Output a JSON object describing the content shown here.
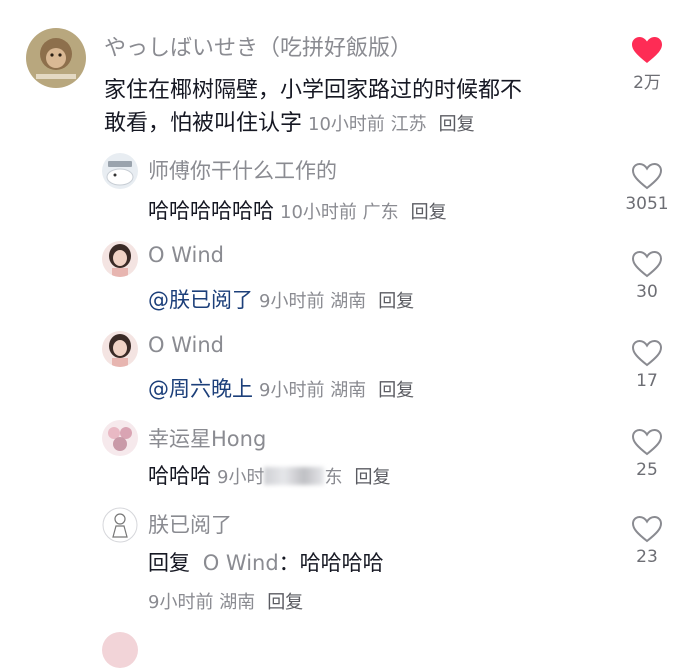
{
  "colors": {
    "accent_like": "#fe2c55",
    "secondary_text": "#8a8b91",
    "primary_text": "#161823"
  },
  "main_comment": {
    "author": "やっしばいせき（吃拼好飯版）",
    "text_line1": "家住在椰树隔壁，小学回家路过的时候都不",
    "text_line2": "敢看，怕被叫住认字",
    "time": "10小时前",
    "location": "江苏",
    "reply_label": "回复",
    "likes": "2万",
    "liked": true,
    "like_icon": "heart-filled-icon"
  },
  "replies": [
    {
      "author": "师傅你干什么工作的",
      "text": "哈哈哈哈哈哈",
      "mention": "",
      "time": "10小时前",
      "location": "广东",
      "reply_label": "回复",
      "likes": "3051",
      "like_icon": "heart-outline-icon"
    },
    {
      "author": "O Wind",
      "text": "",
      "mention": "@朕已阅了",
      "time": "9小时前",
      "location": "湖南",
      "reply_label": "回复",
      "likes": "30",
      "like_icon": "heart-outline-icon"
    },
    {
      "author": "O Wind",
      "text": "",
      "mention": "@周六晚上",
      "time": "9小时前",
      "location": "湖南",
      "reply_label": "回复",
      "likes": "17",
      "like_icon": "heart-outline-icon"
    },
    {
      "author": "幸运星Hong",
      "text": "哈哈哈",
      "mention": "",
      "time_prefix": "9小时",
      "time_suffix": "东",
      "reply_label": "回复",
      "likes": "25",
      "like_icon": "heart-outline-icon"
    },
    {
      "author": "朕已阅了",
      "reply_word": "回复",
      "reply_to": "O Wind",
      "colon": "：",
      "text": "哈哈哈哈",
      "time": "9小时前",
      "location": "湖南",
      "reply_label": "回复",
      "likes": "23",
      "like_icon": "heart-outline-icon"
    }
  ]
}
